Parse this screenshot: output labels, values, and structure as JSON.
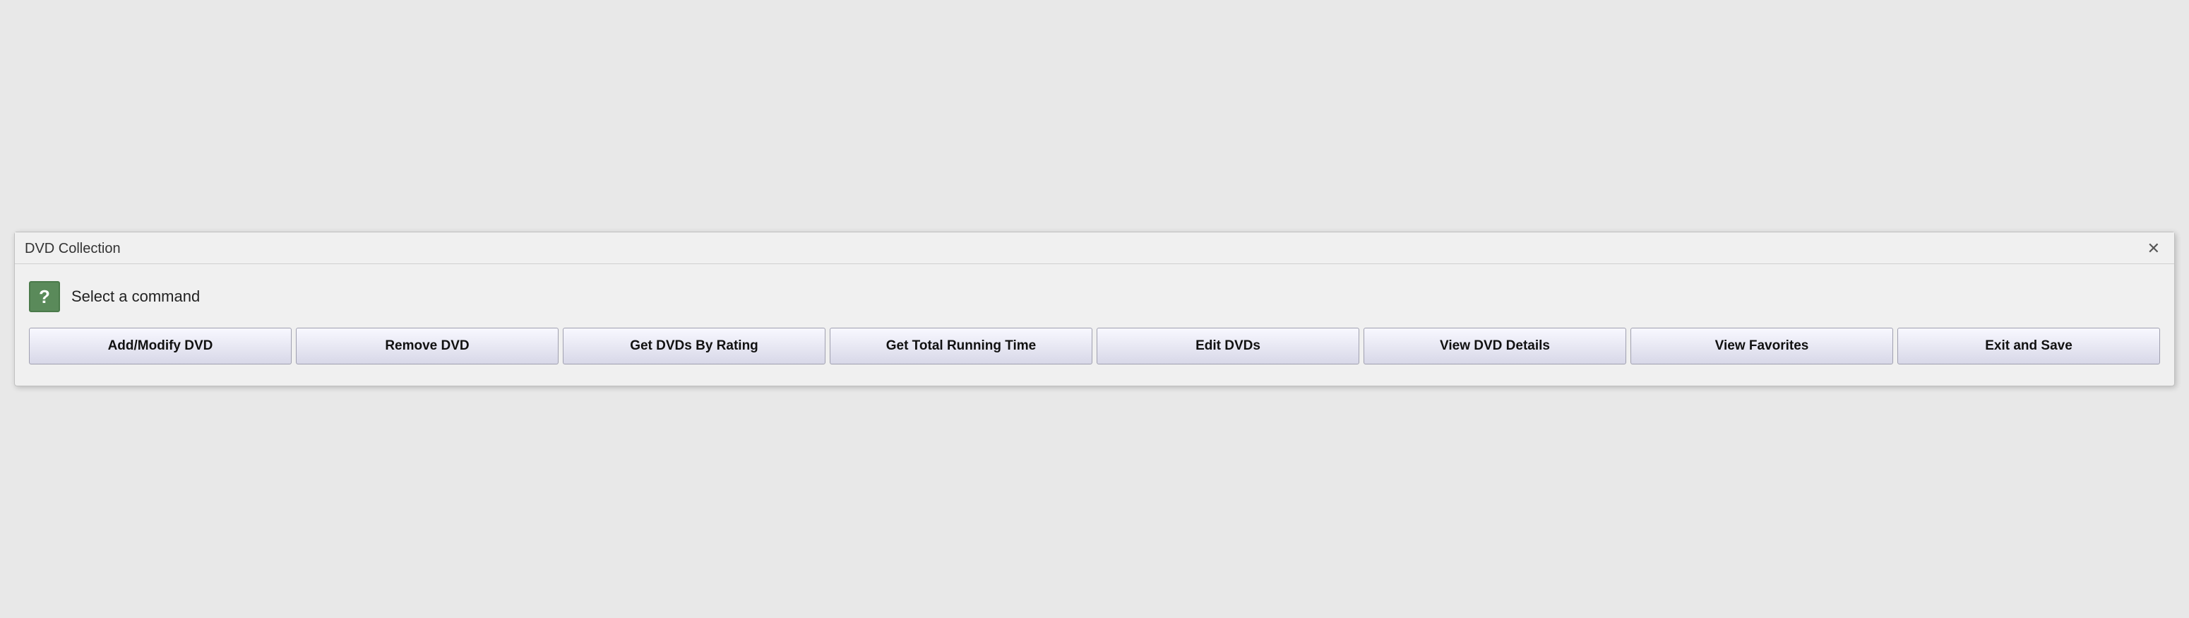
{
  "dialog": {
    "title": "DVD Collection",
    "close_label": "✕",
    "header": {
      "icon_label": "?",
      "instruction": "Select a command"
    },
    "buttons": [
      {
        "id": "add-modify-dvd",
        "label": "Add/Modify DVD"
      },
      {
        "id": "remove-dvd",
        "label": "Remove DVD"
      },
      {
        "id": "get-dvds-by-rating",
        "label": "Get DVDs By Rating"
      },
      {
        "id": "get-total-running-time",
        "label": "Get Total Running Time"
      },
      {
        "id": "edit-dvds",
        "label": "Edit DVDs"
      },
      {
        "id": "view-dvd-details",
        "label": "View DVD Details"
      },
      {
        "id": "view-favorites",
        "label": "View Favorites"
      },
      {
        "id": "exit-and-save",
        "label": "Exit and Save"
      }
    ]
  }
}
